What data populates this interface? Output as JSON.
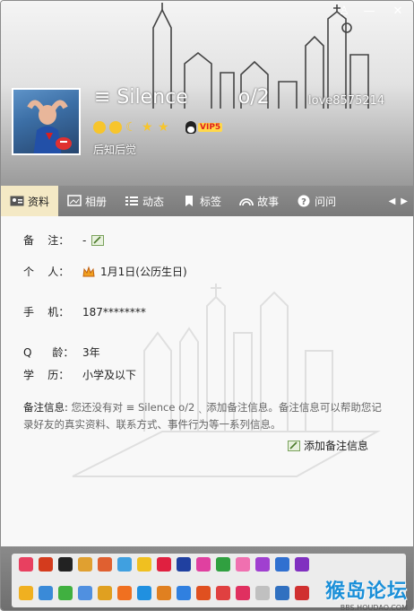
{
  "window": {
    "controls": {
      "skin": "♙",
      "minimize": "—",
      "close": "✕"
    }
  },
  "profile": {
    "nickname": "≡ Silence",
    "nickname_suffix": "o/2",
    "qq_number": "love8575214",
    "vip_label": "VIP5",
    "signature": "后知后觉"
  },
  "tabs": [
    {
      "label": "资料",
      "icon": "id-card-icon",
      "active": true
    },
    {
      "label": "相册",
      "icon": "album-icon",
      "active": false
    },
    {
      "label": "动态",
      "icon": "list-icon",
      "active": false
    },
    {
      "label": "标签",
      "icon": "bookmark-icon",
      "active": false
    },
    {
      "label": "故事",
      "icon": "rainbow-icon",
      "active": false
    },
    {
      "label": "问问",
      "icon": "question-icon",
      "active": false
    }
  ],
  "details": {
    "remark": {
      "label": "备    注：",
      "value": "-"
    },
    "person": {
      "label": "个    人：",
      "value": "1月1日(公历生日)"
    },
    "phone": {
      "label": "手    机：",
      "value": "187********"
    },
    "qage": {
      "label": "Q      龄：",
      "value": "3年"
    },
    "education": {
      "label": "学    历：",
      "value": "小学及以下"
    }
  },
  "note_info": {
    "label": "备注信息:",
    "text": "您还没有对 ≡ Silence        o/2 ˎ  添加备注信息。备注信息可以帮助您记录好友的真实资料、联系方式、事件行为等一系列信息。",
    "add_button": "添加备注信息"
  },
  "watermark": {
    "main": "猴岛论坛",
    "sub": "BBS.HOUDAO.COM"
  },
  "colors": {
    "tab_active": "#f4e9c5",
    "tab_bar": "#858585",
    "vip_red": "#e02020",
    "watermark_blue": "#1a8fd8"
  }
}
